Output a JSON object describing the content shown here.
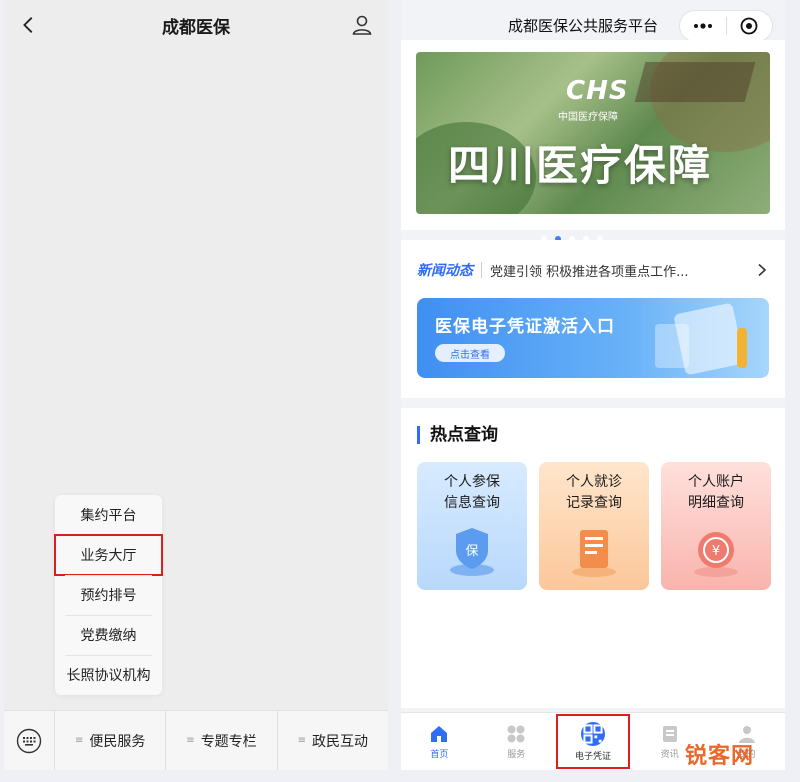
{
  "left": {
    "title": "成都医保",
    "popup_items": [
      "集约平台",
      "业务大厅",
      "预约排号",
      "党费缴纳",
      "长照协议机构"
    ],
    "menu_tabs": [
      "便民服务",
      "专题专栏",
      "政民互动"
    ],
    "icons": [
      "back-arrow-icon",
      "person-icon",
      "keyboard-icon"
    ]
  },
  "right": {
    "title": "成都医保公共服务平台",
    "banner": {
      "logo": "CHS",
      "sub": "中国医疗保障",
      "text": "四川医疗保障",
      "dot_count": 5,
      "active_dot": 1
    },
    "news": {
      "tag": "新闻动态",
      "text": "党建引领 积极推进各项重点工作..."
    },
    "promo": {
      "title": "医保电子凭证激活入口",
      "button": "点击查看"
    },
    "hot": {
      "title": "热点查询",
      "tiles": [
        {
          "line1": "个人参保",
          "line2": "信息查询"
        },
        {
          "line1": "个人就诊",
          "line2": "记录查询"
        },
        {
          "line1": "个人账户",
          "line2": "明细查询"
        }
      ]
    },
    "tabbar": [
      "首页",
      "服务",
      "电子凭证",
      "资讯",
      "我的"
    ],
    "accent": "#2f6df6",
    "highlight_color": "#d9201e"
  },
  "watermark": "锐客网"
}
